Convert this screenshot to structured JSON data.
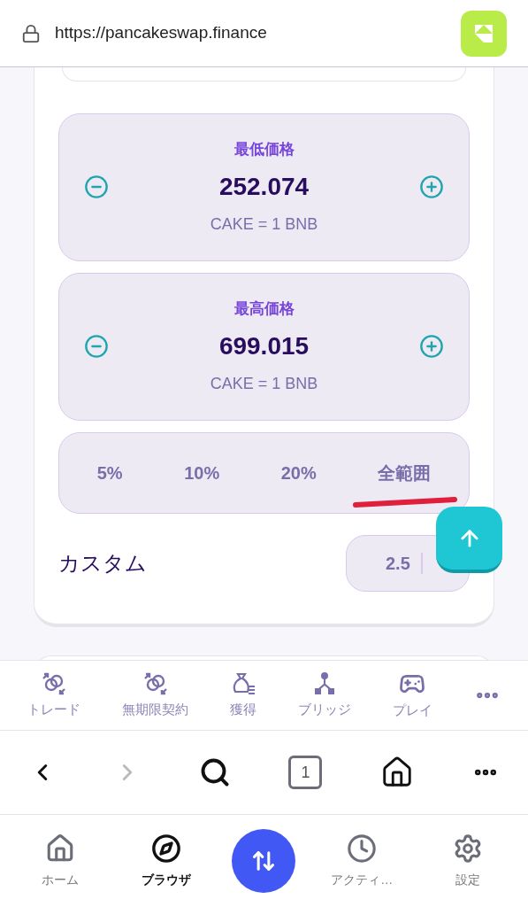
{
  "address_bar": {
    "url": "https://pancakeswap.finance"
  },
  "price_ranges": [
    {
      "label": "最低価格",
      "value": "252.074",
      "unit": "CAKE = 1 BNB"
    },
    {
      "label": "最高価格",
      "value": "699.015",
      "unit": "CAKE = 1 BNB"
    }
  ],
  "presets": [
    {
      "label": "5%",
      "selected": false
    },
    {
      "label": "10%",
      "selected": false
    },
    {
      "label": "20%",
      "selected": false
    },
    {
      "label": "全範囲",
      "selected": false,
      "underlined": true
    }
  ],
  "custom": {
    "label": "カスタム",
    "value": "2.5"
  },
  "site_nav": [
    {
      "kind": "link",
      "label": "トレード"
    },
    {
      "kind": "link",
      "label": "無期限契約"
    },
    {
      "kind": "link",
      "label": "獲得"
    },
    {
      "kind": "link",
      "label": "ブリッジ"
    },
    {
      "kind": "link",
      "label": "プレイ"
    },
    {
      "kind": "more"
    }
  ],
  "browser_toolbar": {
    "back_disabled": false,
    "forward_disabled": true,
    "tab_count": "1"
  },
  "bottom_tabs": [
    {
      "kind": "tab",
      "label": "ホーム",
      "selected": false
    },
    {
      "kind": "tab",
      "label": "ブラウザ",
      "selected": true
    },
    {
      "kind": "action"
    },
    {
      "kind": "tab",
      "label": "アクティ…",
      "selected": false
    },
    {
      "kind": "tab",
      "label": "設定",
      "selected": false
    }
  ]
}
